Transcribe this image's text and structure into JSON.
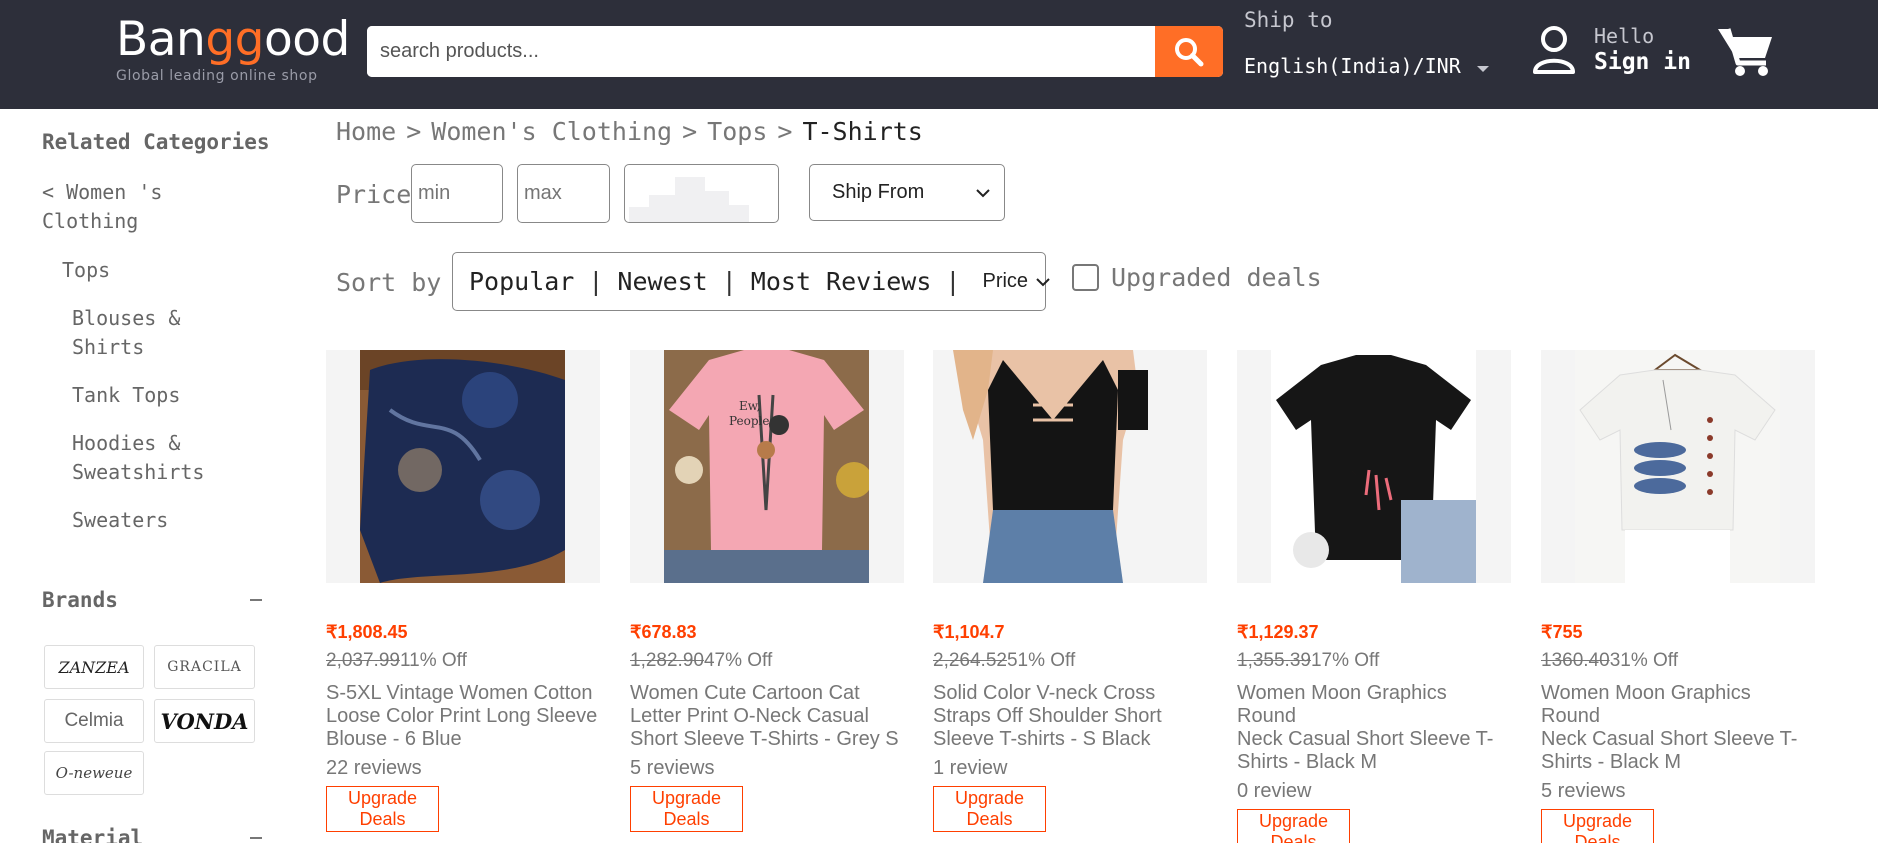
{
  "header": {
    "logo_part1": "Ban",
    "logo_part2": "gg",
    "logo_part3": "ood",
    "tagline": "Global leading online shop",
    "search_placeholder": "search products...",
    "ship_label": "Ship to",
    "ship_value": "English(India)/INR",
    "hello": "Hello",
    "signin": "Sign in",
    "accent_color": "#ff6e26",
    "bg_color": "#2d2f3a"
  },
  "sidebar": {
    "related_title": "Related Categories",
    "back_link_line1": "< Women 's",
    "back_link_line2": "Clothing",
    "tops": "Tops",
    "items": [
      {
        "line1": "Blouses &",
        "line2": "Shirts"
      },
      {
        "line1": "Tank Tops",
        "line2": ""
      },
      {
        "line1": "Hoodies &",
        "line2": "Sweatshirts"
      },
      {
        "line1": "Sweaters",
        "line2": ""
      }
    ],
    "brands_title": "Brands",
    "brands": [
      "ZANZEA",
      "GRACILA",
      "Celmia",
      "VONDA",
      "O-neweue"
    ],
    "material_title": "Material"
  },
  "filters": {
    "breadcrumb": [
      "Home",
      ">",
      "Women's Clothing",
      ">",
      "Tops",
      ">",
      "T-Shirts"
    ],
    "price_label": "Price",
    "min_placeholder": "min",
    "max_placeholder": "max",
    "ship_from": "Ship From",
    "sort_label": "Sort by",
    "sort_options": [
      "Popular",
      "Newest",
      "Most Reviews"
    ],
    "sort_price": "Price",
    "upgraded_deals": "Upgraded deals"
  },
  "products": [
    {
      "price": "₹1,808.45",
      "old": "2,037.99",
      "off": "11% Off",
      "title": [
        "S-5XL Vintage Women Cotton",
        "Loose Color Print Long Sleeve",
        "Blouse - 6 Blue"
      ],
      "reviews": "22 reviews",
      "btn1": "Upgrade",
      "btn2": "Deals"
    },
    {
      "price": "₹678.83",
      "old": "1,282.90",
      "off": "47% Off",
      "title": [
        "Women Cute Cartoon Cat",
        "Letter Print O-Neck Casual",
        "Short Sleeve T-Shirts - Grey S"
      ],
      "reviews": "5 reviews",
      "btn1": "Upgrade",
      "btn2": "Deals"
    },
    {
      "price": "₹1,104.7",
      "old": "2,264.52",
      "off": "51% Off",
      "title": [
        "Solid Color V-neck Cross",
        "Straps Off Shoulder Short",
        "Sleeve T-shirts - S Black"
      ],
      "reviews": "1 review",
      "btn1": "Upgrade",
      "btn2": "Deals"
    },
    {
      "price": "₹1,129.37",
      "old": "1,355.39",
      "off": "17% Off",
      "title": [
        "Women Moon Graphics Round",
        "Neck Casual Short Sleeve T-",
        "Shirts - Black M"
      ],
      "reviews": "0 review",
      "btn1": "Upgrade",
      "btn2": "Deals"
    },
    {
      "price": "₹755",
      "old": "1360.40",
      "off": "31% Off",
      "title": [
        "Women Moon Graphics Round",
        "Neck Casual Short Sleeve T-",
        "Shirts - Black M"
      ],
      "reviews": "5 reviews",
      "btn1": "Upgrade",
      "btn2": "Deals"
    }
  ]
}
